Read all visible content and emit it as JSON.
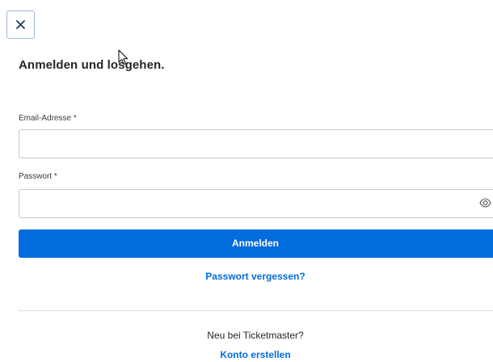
{
  "dialog": {
    "close_icon": "close-icon",
    "title": "Anmelden und losgehen."
  },
  "form": {
    "email_label": "Email-Adresse *",
    "email_value": "",
    "password_label": "Passwort *",
    "password_value": "",
    "password_toggle_icon": "eye-icon",
    "submit_label": "Anmelden",
    "forgot_password_link": "Passwort vergessen?"
  },
  "register": {
    "prompt": "Neu bei Ticketmaster?",
    "link": "Konto erstellen"
  },
  "colors": {
    "primary": "#026cdf",
    "text": "#262626",
    "border": "#c4c9ce"
  }
}
